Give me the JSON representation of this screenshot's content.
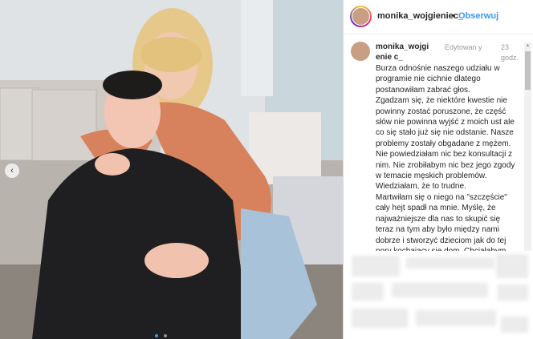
{
  "header": {
    "username": "monika_wojgieniec_",
    "separator": "•",
    "follow_label": "Obserwuj"
  },
  "caption": {
    "username": "monika_wojgienie c_",
    "edited": "Edytowan y",
    "time": "23 godz.",
    "paragraphs": [
      "Burza odnośnie naszego udziału w programie nie cichnie dlatego postanowiłam zabrać głos.",
      "Zgadzam się, że niektóre kwestie nie powinny zostać poruszone, że część słów nie powinna wyjść z moich ust ale co się stało już się nie odstanie. Nasze problemy zostały obgadane z mężem. Nie powiedziałam nic bez konsultacji z nim. Nie zrobiłabym nic bez jego zgody w temacie męskich problemów. Wiedziałam, że to trudne.",
      "Martwiłam się o niego na \"szczęście\" cały hejt spadł na mnie. Myślę, że najważniejsze dla nas to skupić się teraz na tym aby było między nami dobrze i stworzyć dzieciom jak do tej pory kochający się dom. Chciałabym prosić"
    ]
  },
  "colors": {
    "link_blue": "#3897f0",
    "text": "#262626",
    "muted": "#999999"
  },
  "icons": {
    "carousel_prev": "‹"
  }
}
